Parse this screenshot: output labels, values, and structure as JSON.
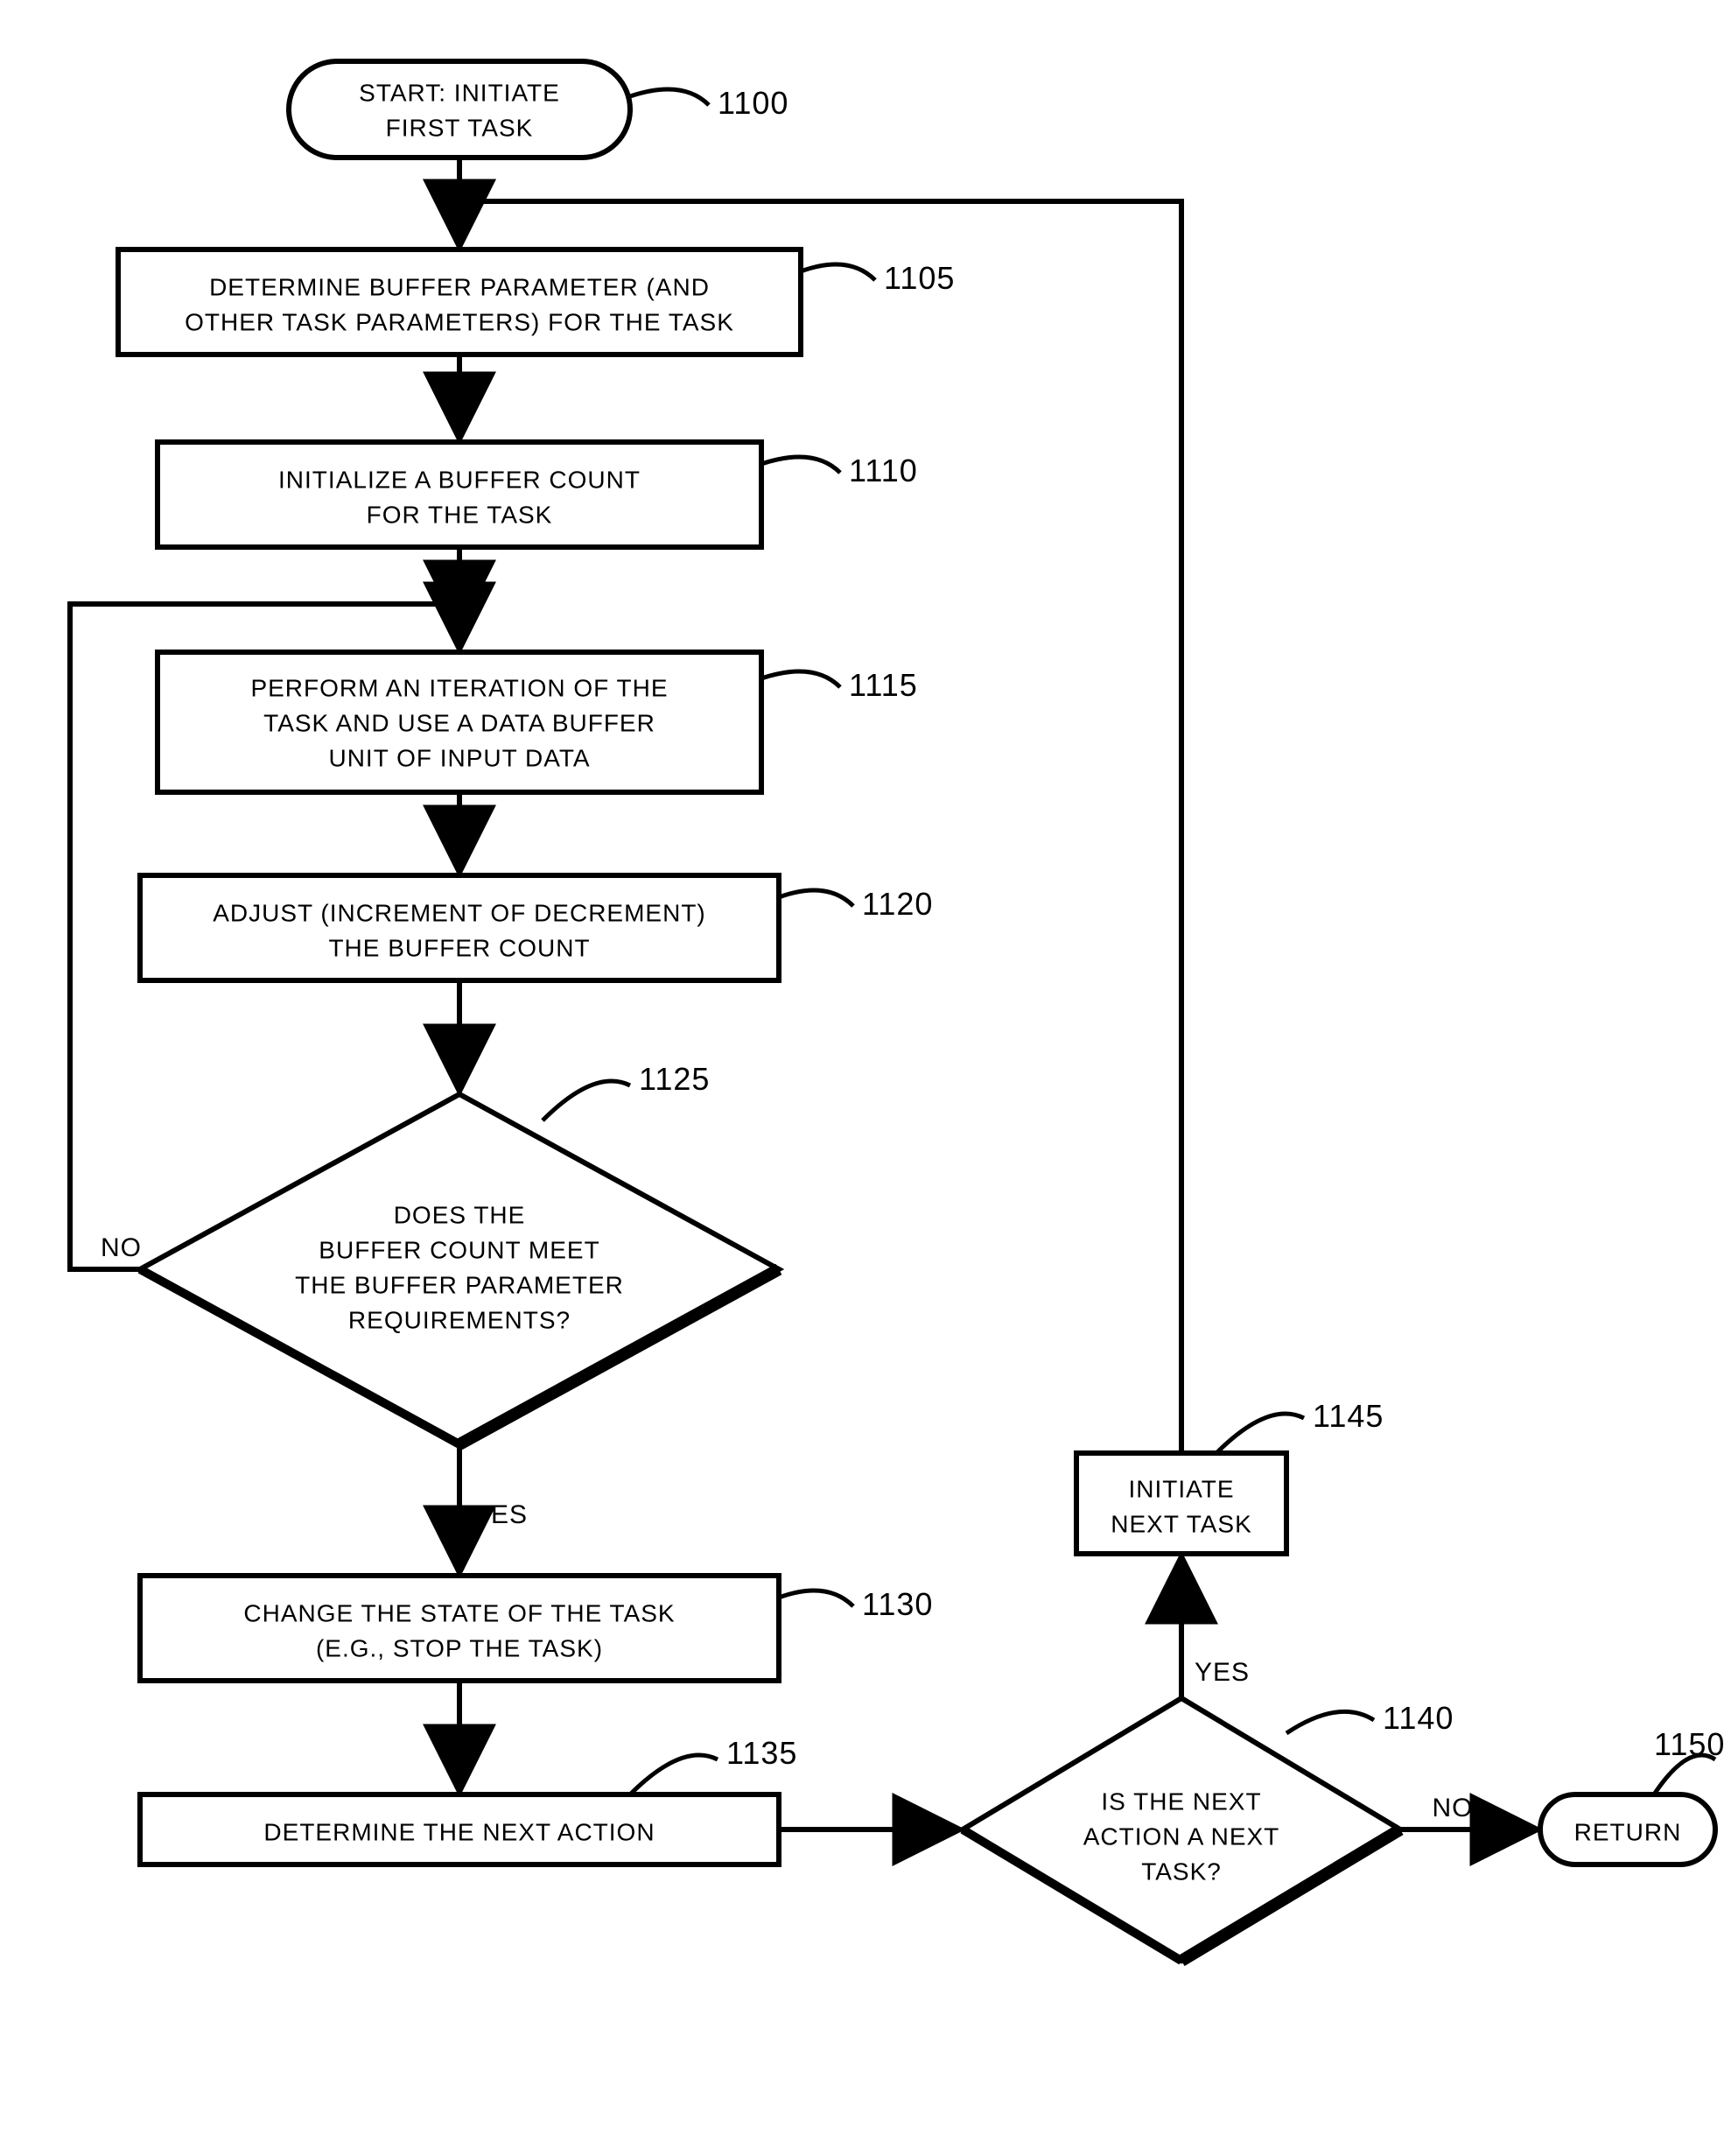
{
  "nodes": {
    "start": {
      "line1": "START: INITIATE",
      "line2": "FIRST TASK",
      "ref": "1100"
    },
    "n1105": {
      "line1": "DETERMINE BUFFER PARAMETER (AND",
      "line2": "OTHER TASK PARAMETERS) FOR THE TASK",
      "ref": "1105"
    },
    "n1110": {
      "line1": "INITIALIZE A BUFFER COUNT",
      "line2": "FOR THE TASK",
      "ref": "1110"
    },
    "n1115": {
      "line1": "PERFORM AN ITERATION OF THE",
      "line2": "TASK AND USE A DATA BUFFER",
      "line3": "UNIT OF INPUT DATA",
      "ref": "1115"
    },
    "n1120": {
      "line1": "ADJUST (INCREMENT OF DECREMENT)",
      "line2": "THE BUFFER COUNT",
      "ref": "1120"
    },
    "d1125": {
      "line1": "DOES THE",
      "line2": "BUFFER COUNT MEET",
      "line3": "THE BUFFER PARAMETER",
      "line4": "REQUIREMENTS?",
      "ref": "1125"
    },
    "n1130": {
      "line1": "CHANGE THE STATE OF THE TASK",
      "line2": "(E.G., STOP THE TASK)",
      "ref": "1130"
    },
    "n1135": {
      "line1": "DETERMINE THE NEXT ACTION",
      "ref": "1135"
    },
    "d1140": {
      "line1": "IS THE NEXT",
      "line2": "ACTION A NEXT",
      "line3": "TASK?",
      "ref": "1140"
    },
    "n1145": {
      "line1": "INITIATE",
      "line2": "NEXT TASK",
      "ref": "1145"
    },
    "return": {
      "line1": "RETURN",
      "ref": "1150"
    }
  },
  "edges": {
    "no": "NO",
    "yes": "YES"
  }
}
